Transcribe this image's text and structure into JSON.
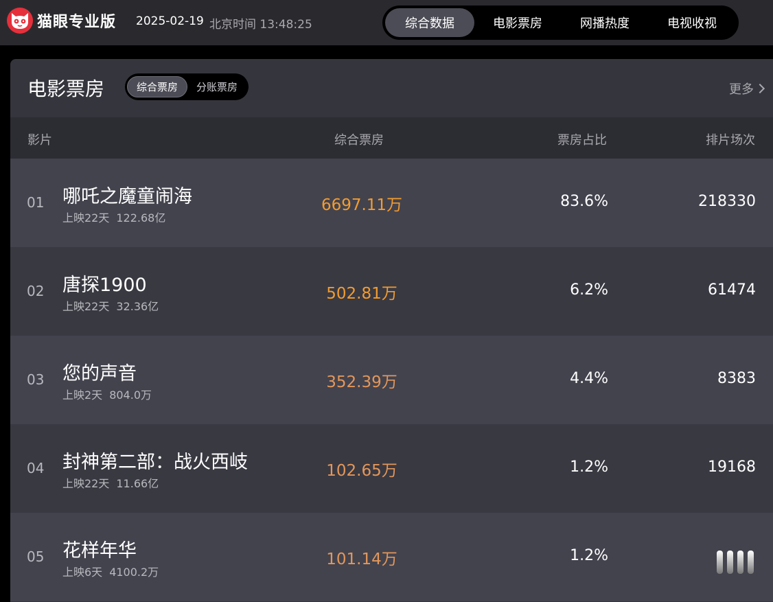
{
  "app": {
    "brand": "猫眼专业版",
    "date": "2025-02-19",
    "clock": "北京时间 13:48:25"
  },
  "nav": {
    "tabs": [
      {
        "label": "综合数据",
        "active": true
      },
      {
        "label": "电影票房",
        "active": false
      },
      {
        "label": "网播热度",
        "active": false
      },
      {
        "label": "电视收视",
        "active": false
      }
    ]
  },
  "panel": {
    "title": "电影票房",
    "subtabs": [
      {
        "label": "综合票房",
        "active": true
      },
      {
        "label": "分账票房",
        "active": false
      }
    ],
    "more": "更多"
  },
  "table": {
    "columns": [
      "影片",
      "综合票房",
      "票房占比",
      "排片场次"
    ],
    "rows": [
      {
        "rank": "01",
        "title": "哪吒之魔童闹海",
        "days": "上映22天",
        "total": "122.68亿",
        "box": "6697.11万",
        "share": "83.6%",
        "shows": "218330"
      },
      {
        "rank": "02",
        "title": "唐探1900",
        "days": "上映22天",
        "total": "32.36亿",
        "box": "502.81万",
        "share": "6.2%",
        "shows": "61474"
      },
      {
        "rank": "03",
        "title": "您的声音",
        "days": "上映2天",
        "total": "804.0万",
        "box": "352.39万",
        "share": "4.4%",
        "shows": "8383"
      },
      {
        "rank": "04",
        "title": "封神第二部：战火西岐",
        "days": "上映22天",
        "total": "11.66亿",
        "box": "102.65万",
        "share": "1.2%",
        "shows": "19168"
      },
      {
        "rank": "05",
        "title": "花样年华",
        "days": "上映6天",
        "total": "4100.2万",
        "box": "101.14万",
        "share": "1.2%",
        "shows": ""
      }
    ]
  },
  "colors": {
    "accent_orange": "#f39c2f",
    "brand_red": "#e5303c",
    "panel_bg": "#35353d"
  },
  "icons": {
    "logo": "cat-logo-icon",
    "more": "chevron-right-icon"
  }
}
